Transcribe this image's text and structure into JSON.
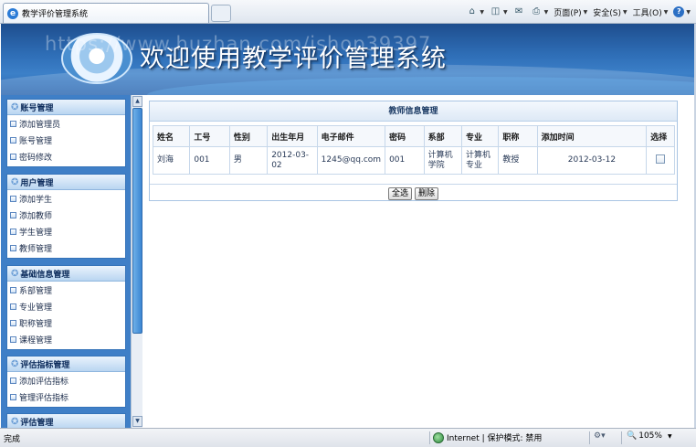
{
  "browser": {
    "tab_title": "教学评价管理系统",
    "commands": [
      {
        "name": "home",
        "label": "",
        "icon": "home-icon"
      },
      {
        "name": "feeds",
        "label": "",
        "icon": "rss-icon"
      },
      {
        "name": "mail",
        "label": "",
        "icon": "mail-icon"
      },
      {
        "name": "print",
        "label": "",
        "icon": "print-icon"
      },
      {
        "name": "page",
        "label": "页面(P)",
        "icon": ""
      },
      {
        "name": "safety",
        "label": "安全(S)",
        "icon": ""
      },
      {
        "name": "tools",
        "label": "工具(O)",
        "icon": ""
      },
      {
        "name": "help",
        "label": "",
        "icon": "help-icon"
      }
    ]
  },
  "banner": {
    "title": "欢迎使用教学评价管理系统",
    "watermark": "https://www.huzhan.com/ishop39397"
  },
  "sidebar": {
    "sections": [
      {
        "title": "账号管理",
        "items": [
          "添加管理员",
          "账号管理",
          "密码修改"
        ]
      },
      {
        "title": "用户管理",
        "items": [
          "添加学生",
          "添加教师",
          "学生管理",
          "教师管理"
        ]
      },
      {
        "title": "基础信息管理",
        "items": [
          "系部管理",
          "专业管理",
          "职称管理",
          "课程管理"
        ]
      },
      {
        "title": "评估指标管理",
        "items": [
          "添加评估指标",
          "管理评估指标"
        ]
      },
      {
        "title": "评估管理",
        "items": []
      }
    ]
  },
  "main": {
    "panel_title": "教师信息管理",
    "columns": [
      "姓名",
      "工号",
      "性别",
      "出生年月",
      "电子邮件",
      "密码",
      "系部",
      "专业",
      "职称",
      "添加时间",
      "选择"
    ],
    "rows": [
      [
        "刘海",
        "001",
        "男",
        "2012-03-02",
        "1245@qq.com",
        "001",
        "计算机学院",
        "计算机专业",
        "教授",
        "2012-03-12"
      ]
    ],
    "select_all_label": "全选",
    "delete_label": "删除"
  },
  "status": {
    "left": "完成",
    "zone": "Internet | 保护模式: 禁用",
    "zoom": "105%"
  },
  "colors": {
    "banner_blue": "#2f6fb8",
    "sidebar_blue": "#3f7fc7"
  }
}
